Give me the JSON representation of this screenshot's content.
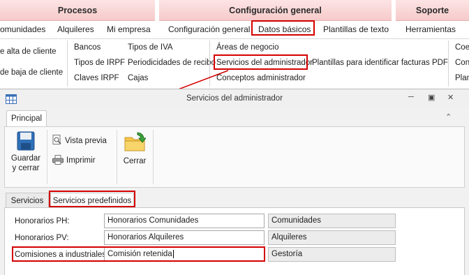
{
  "top_ribbon": {
    "groups": [
      {
        "header": "Procesos"
      },
      {
        "header": "Configuración general"
      },
      {
        "header": "Soporte"
      }
    ],
    "tabs": [
      "omunidades",
      "Alquileres",
      "Mi empresa",
      "Configuración general",
      "Datos básicos",
      "Plantillas de texto",
      "Herramientas"
    ],
    "content": {
      "col1": [
        "e alta de cliente",
        "de baja de cliente"
      ],
      "col2": [
        "Bancos",
        "Tipos de IRPF",
        "Claves IRPF"
      ],
      "col3": [
        "Tipos de IVA",
        "Periodicidades de recibo",
        "Cajas"
      ],
      "col4": [
        "Áreas de negocio",
        "Servicios del administrador",
        "Conceptos administrador"
      ],
      "col5": [
        "Plantillas para identificar facturas PDF"
      ],
      "col6": [
        "Coe",
        "Con",
        "Plan"
      ]
    }
  },
  "window": {
    "title": "Servicios del administrador",
    "ribbon_tab": "Principal",
    "buttons": {
      "save_line1": "Guardar",
      "save_line2": "y cerrar",
      "preview": "Vista previa",
      "print": "Imprimir",
      "close": "Cerrar"
    },
    "tabs": [
      "Servicios",
      "Servicios predefinidos"
    ],
    "rows": [
      {
        "label": "Honorarios PH:",
        "value": "Honorarios Comunidades",
        "category": "Comunidades"
      },
      {
        "label": "Honorarios PV:",
        "value": "Honorarios Alquileres",
        "category": "Alquileres"
      },
      {
        "label": "Comisiones a industriales:",
        "value": "Comisión retenida",
        "category": "Gestoría"
      }
    ]
  },
  "colors": {
    "highlight": "#d40000",
    "group_header": "#f6caca"
  }
}
